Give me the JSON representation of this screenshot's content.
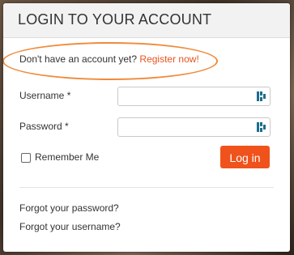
{
  "modal": {
    "title": "LOGIN TO YOUR ACCOUNT"
  },
  "register": {
    "prompt": "Don't have an account yet?",
    "link": "Register now!"
  },
  "form": {
    "username_label": "Username *",
    "username_value": "",
    "password_label": "Password *",
    "password_value": "",
    "remember_label": "Remember Me",
    "remember_checked": false,
    "login_button": "Log in"
  },
  "links": {
    "forgot_password": "Forgot your password?",
    "forgot_username": "Forgot your username?"
  },
  "colors": {
    "accent": "#f0521c",
    "highlight": "#f08a3a",
    "link": "#e8531d",
    "password_manager_icon": "#1b6e8c"
  },
  "icons": [
    "password-manager-icon"
  ]
}
